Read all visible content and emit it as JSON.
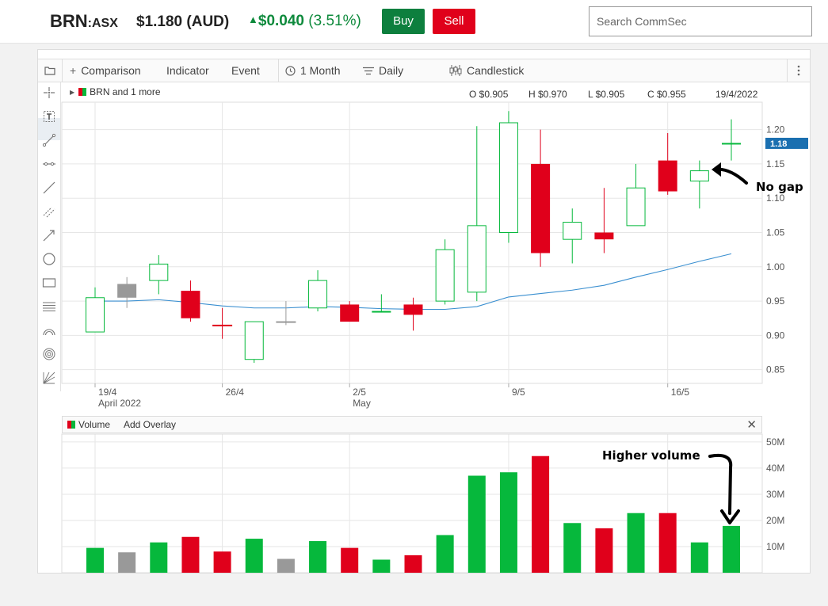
{
  "header": {
    "symbol": "BRN",
    "exchange": ":ASX",
    "price": "$1.180 (AUD)",
    "change_abs": "$0.040",
    "change_pct": "(3.51%)",
    "change_icon": "up-triangle-icon",
    "buy_label": "Buy",
    "sell_label": "Sell",
    "search_placeholder": "Search CommSec"
  },
  "colors": {
    "up": "#06b83c",
    "down": "#e0001b",
    "neutral": "#999999",
    "ma_line": "#3a8fd0",
    "buy": "#0d7f3e",
    "sell": "#e0001b",
    "last_price_tag": "#1a6fb0"
  },
  "toolbar": {
    "comparison": "Comparison",
    "indicator": "Indicator",
    "event": "Event",
    "period": "1 Month",
    "interval": "Daily",
    "chart_type": "Candlestick"
  },
  "legend": {
    "label": "BRN and 1 more",
    "open": "O $0.905",
    "high": "H $0.970",
    "low": "L $0.905",
    "close": "C $0.955",
    "date": "19/4/2022"
  },
  "volume_panel": {
    "title": "Volume",
    "add_overlay": "Add Overlay",
    "close_icon": "close-icon"
  },
  "annotations": {
    "no_gap": "No gap",
    "higher_volume": "Higher volume"
  },
  "chart_data": {
    "type": "candlestick",
    "price_axis": {
      "ticks": [
        "1.20",
        "1.15",
        "1.10",
        "1.05",
        "1.00",
        "0.95",
        "0.90",
        "0.85"
      ],
      "tick_values": [
        1.2,
        1.15,
        1.1,
        1.05,
        1.0,
        0.95,
        0.9,
        0.85
      ],
      "range": [
        0.83,
        1.24
      ]
    },
    "last_price_label": "1.18",
    "last_price": 1.18,
    "x_ticks": [
      {
        "index": 0,
        "label": "19/4",
        "sub": "April 2022"
      },
      {
        "index": 4,
        "label": "26/4",
        "sub": ""
      },
      {
        "index": 8,
        "label": "2/5",
        "sub": "May"
      },
      {
        "index": 13,
        "label": "9/5",
        "sub": ""
      },
      {
        "index": 18,
        "label": "16/5",
        "sub": ""
      }
    ],
    "candles": [
      {
        "o": 0.905,
        "h": 0.97,
        "l": 0.905,
        "c": 0.955,
        "dir": "up"
      },
      {
        "o": 0.955,
        "h": 0.985,
        "l": 0.94,
        "c": 0.975,
        "dir": "flat"
      },
      {
        "o": 0.98,
        "h": 1.017,
        "l": 0.96,
        "c": 1.004,
        "dir": "up"
      },
      {
        "o": 0.965,
        "h": 0.98,
        "l": 0.92,
        "c": 0.925,
        "dir": "down"
      },
      {
        "o": 0.915,
        "h": 0.94,
        "l": 0.895,
        "c": 0.915,
        "dir": "down"
      },
      {
        "o": 0.865,
        "h": 0.92,
        "l": 0.86,
        "c": 0.92,
        "dir": "up"
      },
      {
        "o": 0.92,
        "h": 0.95,
        "l": 0.915,
        "c": 0.92,
        "dir": "flat"
      },
      {
        "o": 0.94,
        "h": 0.995,
        "l": 0.935,
        "c": 0.98,
        "dir": "up"
      },
      {
        "o": 0.945,
        "h": 0.95,
        "l": 0.92,
        "c": 0.92,
        "dir": "down"
      },
      {
        "o": 0.935,
        "h": 0.96,
        "l": 0.935,
        "c": 0.935,
        "dir": "up"
      },
      {
        "o": 0.945,
        "h": 0.955,
        "l": 0.907,
        "c": 0.93,
        "dir": "down"
      },
      {
        "o": 0.95,
        "h": 1.04,
        "l": 0.945,
        "c": 1.025,
        "dir": "up"
      },
      {
        "o": 0.963,
        "h": 1.205,
        "l": 0.95,
        "c": 1.06,
        "dir": "up"
      },
      {
        "o": 1.05,
        "h": 1.227,
        "l": 1.035,
        "c": 1.21,
        "dir": "up"
      },
      {
        "o": 1.15,
        "h": 1.2,
        "l": 1.0,
        "c": 1.02,
        "dir": "down"
      },
      {
        "o": 1.04,
        "h": 1.085,
        "l": 1.005,
        "c": 1.065,
        "dir": "up"
      },
      {
        "o": 1.05,
        "h": 1.115,
        "l": 1.02,
        "c": 1.04,
        "dir": "down"
      },
      {
        "o": 1.06,
        "h": 1.15,
        "l": 1.06,
        "c": 1.115,
        "dir": "up"
      },
      {
        "o": 1.155,
        "h": 1.195,
        "l": 1.105,
        "c": 1.11,
        "dir": "down"
      },
      {
        "o": 1.125,
        "h": 1.155,
        "l": 1.085,
        "c": 1.14,
        "dir": "up"
      },
      {
        "o": 1.18,
        "h": 1.215,
        "l": 1.155,
        "c": 1.18,
        "dir": "up"
      }
    ],
    "moving_average": [
      0.95,
      0.95,
      0.952,
      0.948,
      0.943,
      0.94,
      0.94,
      0.942,
      0.941,
      0.939,
      0.938,
      0.938,
      0.942,
      0.956,
      0.961,
      0.966,
      0.973,
      0.985,
      0.996,
      1.008,
      1.019
    ],
    "volume_axis": {
      "ticks": [
        "50M",
        "40M",
        "30M",
        "20M",
        "10M"
      ],
      "tick_values": [
        50,
        40,
        30,
        20,
        10
      ],
      "range": [
        0,
        53
      ]
    },
    "volume_millions": [
      9.5,
      7.8,
      11.6,
      13.7,
      8.1,
      13.0,
      5.3,
      12.1,
      9.5,
      5.0,
      6.7,
      14.4,
      37.1,
      38.4,
      44.6,
      19.0,
      17.0,
      22.8,
      22.8,
      11.6,
      17.9
    ]
  }
}
